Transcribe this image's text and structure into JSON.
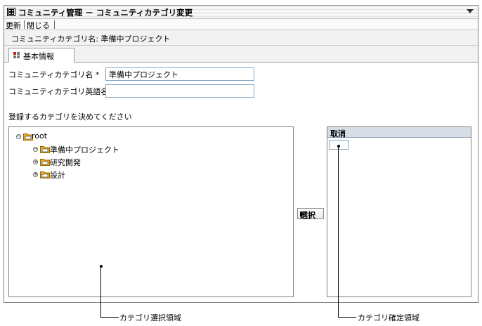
{
  "window": {
    "title": "コミュニティ管理 － コミュニティカテゴリ変更",
    "toolbar": {
      "refresh": "更新",
      "close": "閉じる"
    },
    "subtitle": "コミュニティカテゴリ名: 準備中プロジェクト",
    "tabs": [
      {
        "label": "基本情報"
      }
    ]
  },
  "form": {
    "category_name": {
      "label": "コミュニティカテゴリ名",
      "required_mark": "*",
      "value": "準備中プロジェクト"
    },
    "category_en_name": {
      "label": "コミュニティカテゴリ英語名",
      "value": ""
    },
    "instruction": "登録するカテゴリを決めてください"
  },
  "tree": {
    "root": "root",
    "children": [
      "準備中プロジェクト",
      "研究開発",
      "設計"
    ]
  },
  "select_button": "選択",
  "selected_pane": {
    "header": "取消"
  },
  "annotations": {
    "left": "カテゴリ選択領域",
    "right": "カテゴリ確定領域"
  },
  "colors": {
    "folder": "#f0b020",
    "tab_icon_red": "#cc2200",
    "tab_icon_grey": "#777777",
    "input_border": "#7fa6c8"
  },
  "icons": [
    "window-icon",
    "menu-chevron-icon",
    "tab-grid-icon",
    "collapse-icon",
    "expand-icon",
    "folder-icon",
    "arrow-right-icon"
  ]
}
